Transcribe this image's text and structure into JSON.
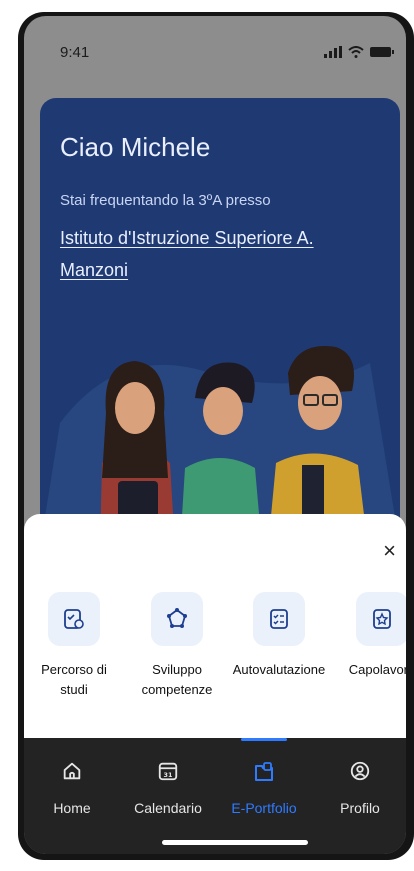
{
  "status_bar": {
    "time": "9:41"
  },
  "hero": {
    "greeting": "Ciao Michele",
    "subtitle": "Stai frequentando la 3ºA presso",
    "school": "Istituto d'Istruzione Superiore A. Manzoni"
  },
  "sheet": {
    "close_label": "×",
    "actions": [
      {
        "label": "Percorso di studi",
        "icon": "study-path-icon"
      },
      {
        "label": "Sviluppo competenze",
        "icon": "skills-development-icon"
      },
      {
        "label": "Autovalutazione",
        "icon": "self-assessment-icon"
      },
      {
        "label": "Capolavoro",
        "icon": "masterpiece-icon"
      }
    ]
  },
  "tabs": [
    {
      "label": "Home",
      "icon": "home-icon",
      "active": false
    },
    {
      "label": "Calendario",
      "icon": "calendar-icon",
      "active": false,
      "icon_text": "31"
    },
    {
      "label": "E-Portfolio",
      "icon": "portfolio-icon",
      "active": true
    },
    {
      "label": "Profilo",
      "icon": "profile-icon",
      "active": false
    }
  ],
  "colors": {
    "accent": "#2f7bff",
    "card": "#1f3a73",
    "tabbar": "#232323",
    "tile": "#eaf1fb"
  }
}
